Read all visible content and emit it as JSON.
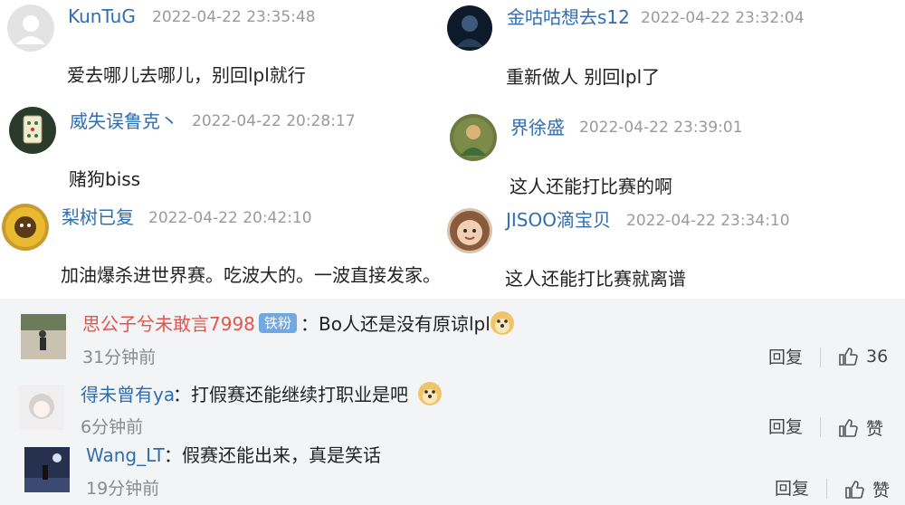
{
  "top_comments": [
    {
      "name": "KunTuG",
      "time": "2022-04-22 23:35:48",
      "text": "爱去哪儿去哪儿，别回lpl就行"
    },
    {
      "name": "威失误鲁克丶",
      "time": "2022-04-22 20:28:17",
      "text": "赌狗biss"
    },
    {
      "name": "梨树已复",
      "time": "2022-04-22 20:42:10",
      "text": "加油爆杀进世界赛。吃波大的。一波直接发家。"
    },
    {
      "name": "金咕咕想去s12",
      "time": "2022-04-22 23:32:04",
      "text": "重新做人 别回lpl了"
    },
    {
      "name": "界徐盛",
      "time": "2022-04-22 23:39:01",
      "text": "这人还能打比赛的啊"
    },
    {
      "name": "JISOO滴宝贝",
      "time": "2022-04-22 23:34:10",
      "text": "这人还能打比赛就离谱"
    }
  ],
  "bottom_comments": [
    {
      "name": "思公子兮未敢言7998",
      "badge": "铁粉",
      "text": "：Bo人还是没有原谅lpl",
      "time": "31分钟前",
      "reply": "回复",
      "likes": "36",
      "emoji": "doge-icon"
    },
    {
      "name": "得未曾有ya",
      "text": "：打假赛还能继续打职业是吧",
      "time": "6分钟前",
      "reply": "回复",
      "likes": "赞",
      "emoji": "doge-icon"
    },
    {
      "name": "Wang_LT",
      "text": "：假赛还能出来，真是笑话",
      "time": "19分钟前",
      "reply": "回复",
      "likes": "赞"
    }
  ],
  "colors": {
    "name": "#2f6db3",
    "name_highlight": "#e5534b",
    "badge": "#72a8e0",
    "time": "#9a9a9a",
    "panel": "#f3f4f6"
  }
}
